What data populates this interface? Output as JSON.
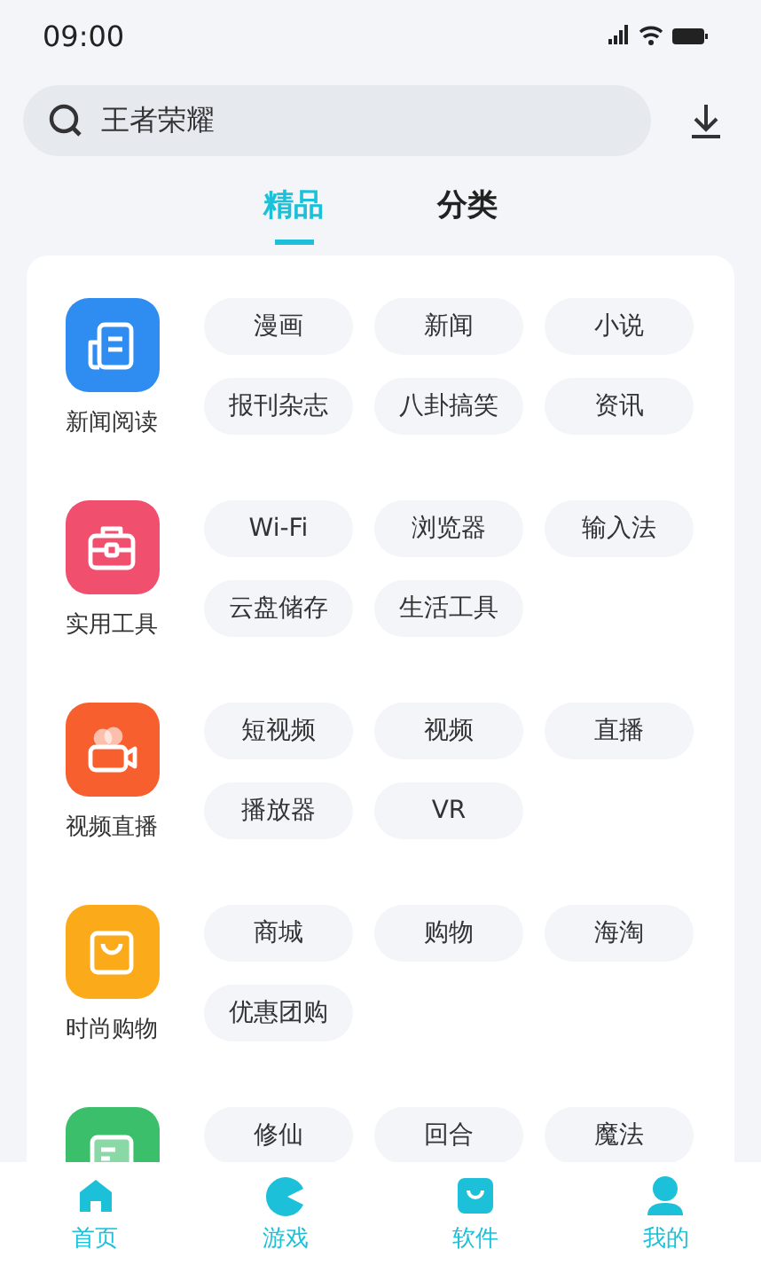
{
  "status_bar": {
    "time": "09:00"
  },
  "search": {
    "value": "王者荣耀"
  },
  "tabs": [
    {
      "label": "精品",
      "selected": true
    },
    {
      "label": "分类",
      "selected": false
    }
  ],
  "categories": [
    {
      "kind": "news",
      "color": "#2f8cf0",
      "label": "新闻阅读",
      "tags": [
        "漫画",
        "新闻",
        "小说",
        "报刊杂志",
        "八卦搞笑",
        "资讯"
      ]
    },
    {
      "kind": "tools",
      "color": "#f0506e",
      "label": "实用工具",
      "tags": [
        "Wi-Fi",
        "浏览器",
        "输入法",
        "云盘储存",
        "生活工具"
      ]
    },
    {
      "kind": "video",
      "color": "#f7602e",
      "label": "视频直播",
      "tags": [
        "短视频",
        "视频",
        "直播",
        "播放器",
        "VR"
      ]
    },
    {
      "kind": "shopping",
      "color": "#fbaa1a",
      "label": "时尚购物",
      "tags": [
        "商城",
        "购物",
        "海淘",
        "优惠团购"
      ]
    },
    {
      "kind": "games",
      "color": "#3cbf6a",
      "tags": [
        "修仙",
        "回合",
        "魔法"
      ]
    }
  ],
  "nav": [
    {
      "kind": "home",
      "label": "首页"
    },
    {
      "kind": "games",
      "label": "游戏"
    },
    {
      "kind": "apps",
      "label": "软件"
    },
    {
      "kind": "me",
      "label": "我的"
    }
  ]
}
